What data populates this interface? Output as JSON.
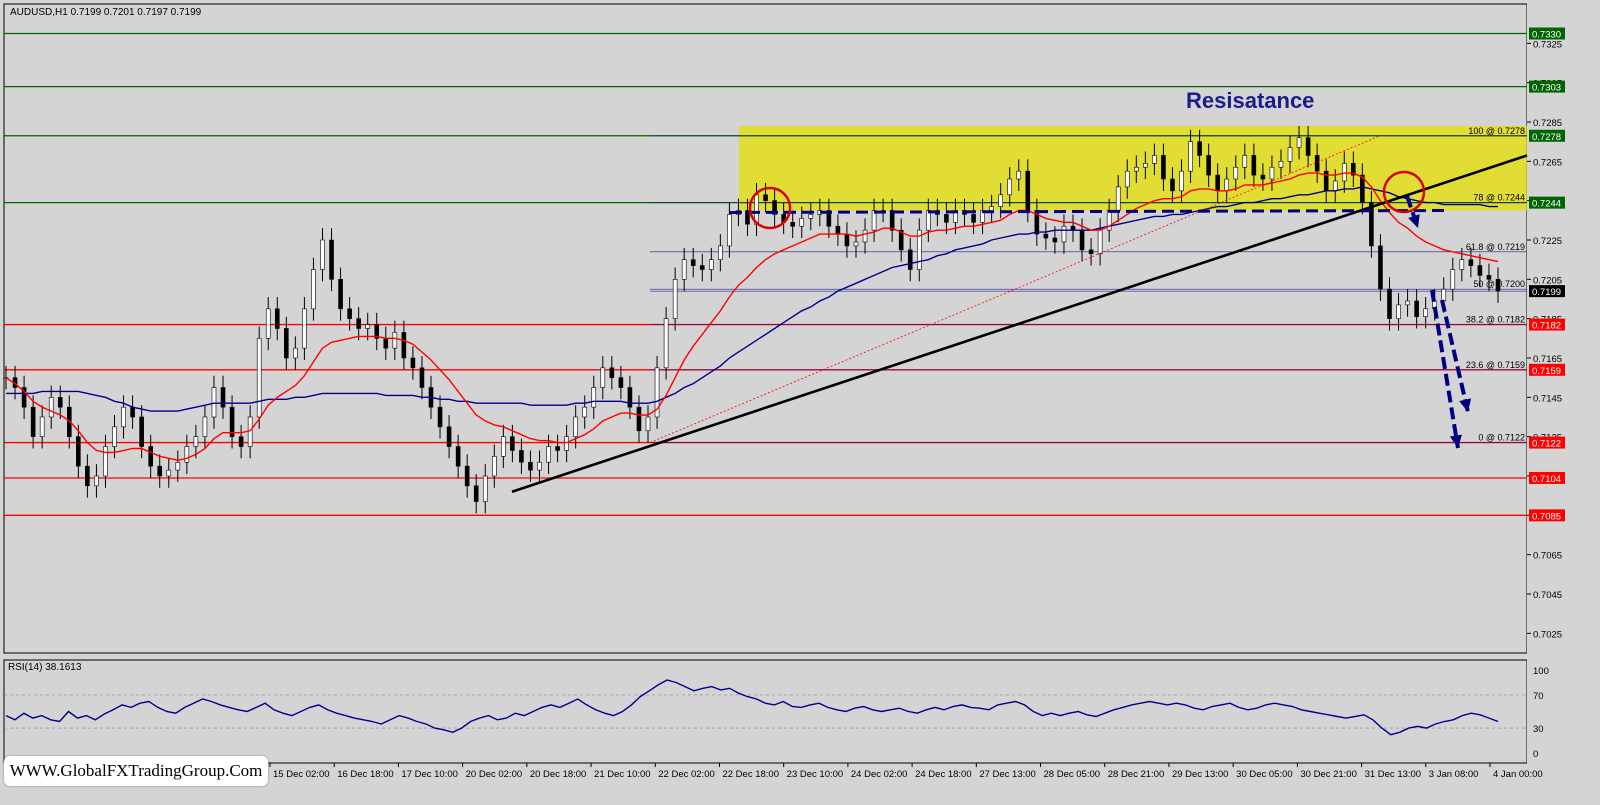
{
  "header": {
    "instrument_line": "AUDUSD,H1  0.7199 0.7201 0.7197 0.7199",
    "rsi_label": "RSI(14) 38.1613"
  },
  "watermark": "WWW.GlobalFXTradingGroup.Com",
  "annotation": "Resisatance",
  "colors": {
    "background": "#d4d4d4",
    "support_line": "#ff0000",
    "resistance_line": "#006400",
    "zone": "#e6e000",
    "ma_fast": "#ff0000",
    "ma_slow": "#00008b",
    "rsi": "#00008b",
    "arrow": "#000080"
  },
  "chart_data": {
    "type": "line",
    "symbol": "AUDUSD",
    "timeframe": "H1",
    "ylim": [
      0.7015,
      0.7345
    ],
    "y_ticks": [
      "0.7325",
      "0.7305",
      "0.7285",
      "0.7265",
      "0.7245",
      "0.7225",
      "0.7205",
      "0.7185",
      "0.7165",
      "0.7145",
      "0.7125",
      "0.7105",
      "0.7085",
      "0.7065",
      "0.7045",
      "0.7025"
    ],
    "x_ticks": [
      "15 Dec 02:00",
      "16 Dec 18:00",
      "17 Dec 10:00",
      "20 Dec 02:00",
      "20 Dec 18:00",
      "21 Dec 10:00",
      "22 Dec 02:00",
      "22 Dec 18:00",
      "23 Dec 10:00",
      "24 Dec 02:00",
      "24 Dec 18:00",
      "27 Dec 13:00",
      "28 Dec 05:00",
      "28 Dec 21:00",
      "29 Dec 13:00",
      "30 Dec 05:00",
      "30 Dec 21:00",
      "31 Dec 13:00",
      "3 Jan 08:00",
      "4 Jan 00:00"
    ],
    "price_levels": [
      {
        "label": "0.7330",
        "value": 0.733,
        "type": "resistance"
      },
      {
        "label": "0.7303",
        "value": 0.7303,
        "type": "resistance"
      },
      {
        "label": "0.7278",
        "value": 0.7278,
        "type": "resistance"
      },
      {
        "label": "0.7244",
        "value": 0.7244,
        "type": "resistance"
      },
      {
        "label": "0.7199",
        "value": 0.7199,
        "type": "current"
      },
      {
        "label": "0.7182",
        "value": 0.7182,
        "type": "support"
      },
      {
        "label": "0.7159",
        "value": 0.7159,
        "type": "support"
      },
      {
        "label": "0.7122",
        "value": 0.7122,
        "type": "support"
      },
      {
        "label": "0.7104",
        "value": 0.7104,
        "type": "support"
      },
      {
        "label": "0.7085",
        "value": 0.7085,
        "type": "support"
      }
    ],
    "fib_levels": [
      {
        "label": "100 @ 0.7278",
        "value": 0.7278
      },
      {
        "label": "78 @ 0.7244",
        "value": 0.7244
      },
      {
        "label": "61.8 @ 0.7219",
        "value": 0.7219
      },
      {
        "label": "50 @ 0.7200",
        "value": 0.72
      },
      {
        "label": "38.2 @ 0.7182",
        "value": 0.7182
      },
      {
        "label": "23.6 @ 0.7159",
        "value": 0.7159
      },
      {
        "label": "0 @ 0.7122",
        "value": 0.7122
      }
    ],
    "resistance_zone": {
      "from": 0.724,
      "to": 0.7283
    },
    "series": [
      {
        "values": [
          0.7155,
          0.715,
          0.714,
          0.7125,
          0.7135,
          0.7145,
          0.714,
          0.7125,
          0.711,
          0.71,
          0.7105,
          0.712,
          0.713,
          0.714,
          0.7135,
          0.712,
          0.711,
          0.7105,
          0.7108,
          0.7112,
          0.712,
          0.7125,
          0.7135,
          0.715,
          0.714,
          0.7125,
          0.712,
          0.7135,
          0.7175,
          0.719,
          0.718,
          0.7165,
          0.717,
          0.719,
          0.721,
          0.7225,
          0.7205,
          0.719,
          0.7185,
          0.718,
          0.7182,
          0.7175,
          0.717,
          0.7178,
          0.7165,
          0.716,
          0.715,
          0.714,
          0.713,
          0.712,
          0.711,
          0.71,
          0.7092,
          0.7105,
          0.7115,
          0.7125,
          0.7118,
          0.7112,
          0.7108,
          0.7112,
          0.712,
          0.7118,
          0.7125,
          0.7135,
          0.714,
          0.715,
          0.716,
          0.7155,
          0.715,
          0.714,
          0.7128,
          0.7135,
          0.716,
          0.7185,
          0.7205,
          0.7215,
          0.7212,
          0.721,
          0.7215,
          0.7222,
          0.7238,
          0.724,
          0.7233,
          0.7248,
          0.7245,
          0.7238,
          0.7234,
          0.7232,
          0.7236,
          0.7238,
          0.724,
          0.7232,
          0.7228,
          0.7222,
          0.7224,
          0.723,
          0.724,
          0.724,
          0.723,
          0.722,
          0.721,
          0.723,
          0.724,
          0.7238,
          0.7234,
          0.724,
          0.7238,
          0.7234,
          0.724,
          0.7242,
          0.7248,
          0.7256,
          0.726,
          0.724,
          0.7228,
          0.7226,
          0.7224,
          0.7232,
          0.723,
          0.722,
          0.7218,
          0.723,
          0.724,
          0.7252,
          0.726,
          0.7262,
          0.7264,
          0.7268,
          0.7256,
          0.725,
          0.726,
          0.7275,
          0.7268,
          0.7258,
          0.725,
          0.7256,
          0.7262,
          0.7268,
          0.7258,
          0.7256,
          0.7262,
          0.7265,
          0.7272,
          0.7277,
          0.7268,
          0.726,
          0.725,
          0.7255,
          0.7264,
          0.7258,
          0.7244,
          0.7222,
          0.72,
          0.7185,
          0.7192,
          0.7194,
          0.7186,
          0.719,
          0.7194,
          0.72,
          0.721,
          0.7215,
          0.7212,
          0.7207,
          0.7205,
          0.7199
        ]
      },
      {
        "name": "",
        "values": [
          0.7155,
          0.7152,
          0.7148,
          0.7143,
          0.714,
          0.7138,
          0.7136,
          0.7133,
          0.7128,
          0.7122,
          0.7118,
          0.7117,
          0.7117,
          0.7118,
          0.7119,
          0.7119,
          0.7117,
          0.7115,
          0.7114,
          0.7113,
          0.7114,
          0.7116,
          0.7119,
          0.7124,
          0.7127,
          0.7127,
          0.7127,
          0.7128,
          0.7134,
          0.7141,
          0.7145,
          0.7148,
          0.7151,
          0.7156,
          0.7163,
          0.717,
          0.7173,
          0.7174,
          0.7175,
          0.7176,
          0.7176,
          0.7176,
          0.7175,
          0.7175,
          0.7174,
          0.7172,
          0.7168,
          0.7164,
          0.7159,
          0.7154,
          0.7148,
          0.7142,
          0.7136,
          0.7133,
          0.7131,
          0.713,
          0.7128,
          0.7126,
          0.7124,
          0.7123,
          0.7123,
          0.7122,
          0.7122,
          0.7124,
          0.7126,
          0.7129,
          0.7133,
          0.7135,
          0.7137,
          0.7137,
          0.7136,
          0.7136,
          0.7139,
          0.7146,
          0.7155,
          0.7164,
          0.7171,
          0.7177,
          0.7183,
          0.7189,
          0.7196,
          0.7202,
          0.7206,
          0.7211,
          0.7215,
          0.7218,
          0.722,
          0.7222,
          0.7224,
          0.7226,
          0.7228,
          0.7228,
          0.7228,
          0.7228,
          0.7227,
          0.7228,
          0.7229,
          0.7231,
          0.7231,
          0.7229,
          0.7227,
          0.7227,
          0.7229,
          0.723,
          0.723,
          0.7231,
          0.7232,
          0.7232,
          0.7233,
          0.7234,
          0.7235,
          0.7238,
          0.724,
          0.724,
          0.7238,
          0.7236,
          0.7235,
          0.7234,
          0.7234,
          0.7232,
          0.723,
          0.723,
          0.7232,
          0.7235,
          0.7238,
          0.7241,
          0.7243,
          0.7245,
          0.7246,
          0.7246,
          0.7247,
          0.725,
          0.7251,
          0.7251,
          0.725,
          0.725,
          0.7251,
          0.7253,
          0.7253,
          0.7253,
          0.7254,
          0.7255,
          0.7256,
          0.7258,
          0.7259,
          0.7259,
          0.7258,
          0.7258,
          0.7259,
          0.7259,
          0.7257,
          0.7252,
          0.7245,
          0.7239,
          0.7234,
          0.7231,
          0.7227,
          0.7224,
          0.7222,
          0.722,
          0.7219,
          0.7218,
          0.7217,
          0.7216,
          0.7215,
          0.7214
        ]
      },
      {
        "name": "",
        "values": [
          0.7147,
          0.7147,
          0.7147,
          0.7147,
          0.7148,
          0.7148,
          0.7148,
          0.7148,
          0.7148,
          0.7147,
          0.7146,
          0.7145,
          0.7143,
          0.7142,
          0.714,
          0.7139,
          0.7138,
          0.7138,
          0.7138,
          0.7138,
          0.7139,
          0.714,
          0.7141,
          0.7142,
          0.7142,
          0.7142,
          0.7142,
          0.7142,
          0.7143,
          0.7144,
          0.7144,
          0.7144,
          0.7145,
          0.7145,
          0.7146,
          0.7147,
          0.7147,
          0.7147,
          0.7147,
          0.7147,
          0.7147,
          0.7147,
          0.7146,
          0.7146,
          0.7146,
          0.7146,
          0.7145,
          0.7145,
          0.7144,
          0.7144,
          0.7143,
          0.7143,
          0.7142,
          0.7142,
          0.7142,
          0.7142,
          0.7142,
          0.7142,
          0.7141,
          0.7141,
          0.7141,
          0.7141,
          0.7141,
          0.7142,
          0.7142,
          0.7143,
          0.7143,
          0.7143,
          0.7143,
          0.7142,
          0.7142,
          0.7142,
          0.7143,
          0.7145,
          0.7147,
          0.715,
          0.7152,
          0.7155,
          0.7158,
          0.7161,
          0.7165,
          0.7168,
          0.7171,
          0.7174,
          0.7177,
          0.718,
          0.7183,
          0.7186,
          0.7189,
          0.7191,
          0.7194,
          0.7196,
          0.7199,
          0.7201,
          0.7203,
          0.7205,
          0.7207,
          0.7209,
          0.7211,
          0.7212,
          0.7213,
          0.7214,
          0.7215,
          0.7217,
          0.7218,
          0.722,
          0.7221,
          0.7222,
          0.7223,
          0.7225,
          0.7226,
          0.7227,
          0.7228,
          0.7228,
          0.7229,
          0.7229,
          0.723,
          0.723,
          0.723,
          0.723,
          0.723,
          0.7231,
          0.7232,
          0.7233,
          0.7234,
          0.7235,
          0.7236,
          0.7237,
          0.7237,
          0.7238,
          0.7238,
          0.7239,
          0.724,
          0.7241,
          0.7242,
          0.7242,
          0.7243,
          0.7244,
          0.7244,
          0.7245,
          0.7246,
          0.7246,
          0.7247,
          0.7248,
          0.7248,
          0.7249,
          0.725,
          0.725,
          0.7251,
          0.7251,
          0.7252,
          0.7251,
          0.725,
          0.7249,
          0.7247,
          0.7246,
          0.7245,
          0.7244,
          0.7244,
          0.7243,
          0.7243,
          0.7243,
          0.7243,
          0.7243,
          0.7242,
          0.7242
        ]
      }
    ],
    "rsi": {
      "label": "RSI(14) 38.1613",
      "ylim": [
        0,
        100
      ],
      "y_ticks": [
        "100",
        "70",
        "30",
        "0"
      ],
      "values": [
        45,
        40,
        48,
        42,
        45,
        40,
        38,
        50,
        42,
        45,
        40,
        47,
        52,
        58,
        55,
        60,
        62,
        55,
        50,
        48,
        55,
        60,
        65,
        62,
        58,
        55,
        52,
        50,
        55,
        60,
        52,
        48,
        45,
        50,
        55,
        58,
        52,
        48,
        45,
        42,
        40,
        38,
        35,
        40,
        45,
        42,
        38,
        35,
        30,
        28,
        25,
        30,
        38,
        42,
        45,
        40,
        42,
        48,
        45,
        50,
        55,
        58,
        55,
        60,
        65,
        58,
        52,
        48,
        45,
        50,
        58,
        68,
        75,
        82,
        88,
        85,
        80,
        75,
        78,
        80,
        76,
        78,
        72,
        68,
        65,
        60,
        58,
        62,
        56,
        55,
        58,
        60,
        55,
        52,
        50,
        54,
        56,
        52,
        50,
        52,
        54,
        50,
        48,
        52,
        55,
        52,
        56,
        58,
        55,
        54,
        52,
        58,
        60,
        62,
        58,
        50,
        45,
        48,
        45,
        48,
        50,
        46,
        44,
        48,
        52,
        55,
        58,
        60,
        62,
        60,
        58,
        60,
        58,
        54,
        52,
        56,
        58,
        60,
        55,
        52,
        54,
        58,
        60,
        58,
        56,
        52,
        50,
        48,
        46,
        44,
        42,
        44,
        46,
        40,
        30,
        22,
        25,
        30,
        32,
        30,
        35,
        38,
        40,
        45,
        48,
        46,
        42,
        38
      ]
    }
  }
}
